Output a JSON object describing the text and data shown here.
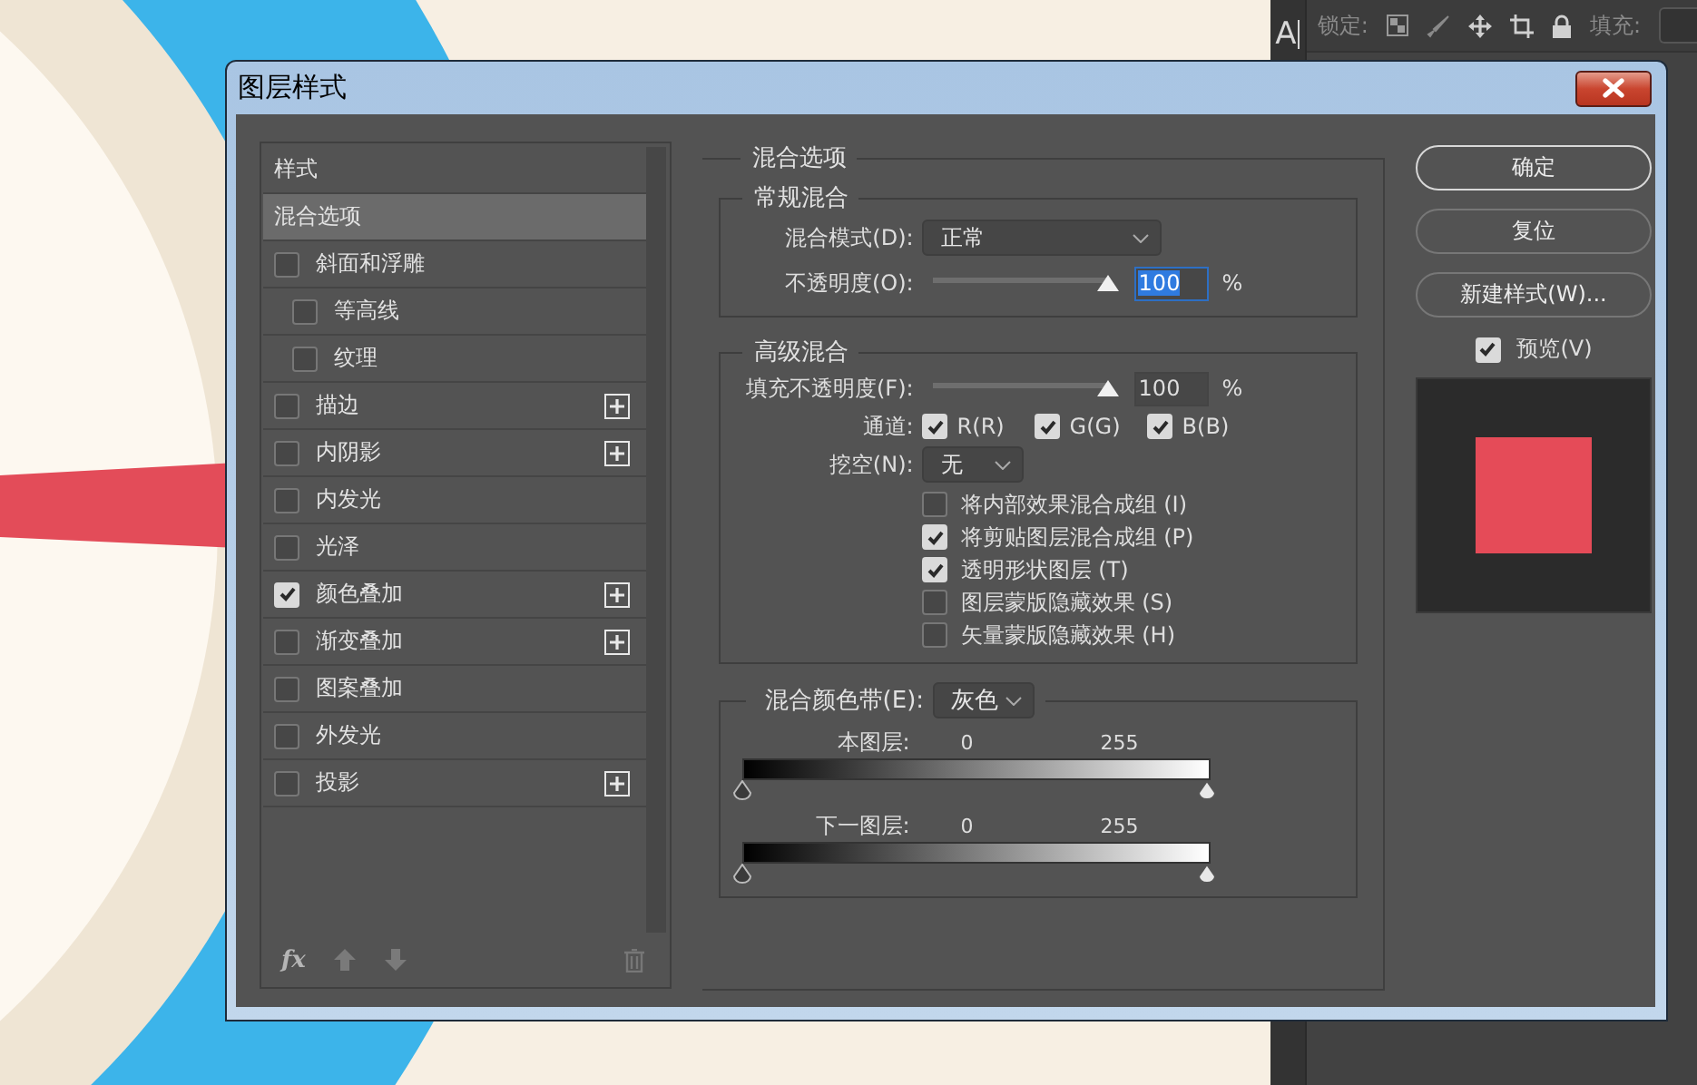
{
  "app": {
    "type_tool": "A",
    "lock_label": "锁定:",
    "fill_label": "填充:"
  },
  "dialog": {
    "title": "图层样式",
    "styles": {
      "items": [
        {
          "kind": "header",
          "label": "样式",
          "selected": false
        },
        {
          "kind": "option",
          "label": "混合选项",
          "selected": true
        },
        {
          "kind": "effect",
          "label": "斜面和浮雕",
          "checked": false,
          "addable": false,
          "selected": false,
          "children": [
            {
              "kind": "effect",
              "label": "等高线",
              "checked": false,
              "addable": false,
              "selected": false
            },
            {
              "kind": "effect",
              "label": "纹理",
              "checked": false,
              "addable": false,
              "selected": false
            }
          ]
        },
        {
          "kind": "effect",
          "label": "描边",
          "checked": false,
          "addable": true,
          "selected": false
        },
        {
          "kind": "effect",
          "label": "内阴影",
          "checked": false,
          "addable": true,
          "selected": false
        },
        {
          "kind": "effect",
          "label": "内发光",
          "checked": false,
          "addable": false,
          "selected": false
        },
        {
          "kind": "effect",
          "label": "光泽",
          "checked": false,
          "addable": false,
          "selected": false
        },
        {
          "kind": "effect",
          "label": "颜色叠加",
          "checked": true,
          "addable": true,
          "selected": false
        },
        {
          "kind": "effect",
          "label": "渐变叠加",
          "checked": false,
          "addable": true,
          "selected": false
        },
        {
          "kind": "effect",
          "label": "图案叠加",
          "checked": false,
          "addable": false,
          "selected": false
        },
        {
          "kind": "effect",
          "label": "外发光",
          "checked": false,
          "addable": false,
          "selected": false
        },
        {
          "kind": "effect",
          "label": "投影",
          "checked": false,
          "addable": true,
          "selected": false
        }
      ],
      "fx_label": "fx"
    },
    "blending": {
      "title": "混合选项",
      "general": {
        "title": "常规混合",
        "mode": {
          "label": "混合模式(D):",
          "value": "正常"
        },
        "opacity": {
          "label": "不透明度(O):",
          "level": 1,
          "value": "100",
          "unit": "%",
          "focused": true
        }
      },
      "advanced": {
        "title": "高级混合",
        "fill_opacity": {
          "label": "填充不透明度(F):",
          "level": 1,
          "value": "100",
          "unit": "%",
          "focused": false
        },
        "channels_label": "通道:",
        "channels": [
          {
            "label": "R(R)",
            "checked": true
          },
          {
            "label": "G(G)",
            "checked": true
          },
          {
            "label": "B(B)",
            "checked": true
          }
        ],
        "knockout": {
          "label": "挖空(N):",
          "value": "无"
        },
        "options": [
          {
            "label": "将内部效果混合成组 (I)",
            "checked": false
          },
          {
            "label": "将剪贴图层混合成组 (P)",
            "checked": true
          },
          {
            "label": "透明形状图层 (T)",
            "checked": true
          },
          {
            "label": "图层蒙版隐藏效果 (S)",
            "checked": false
          },
          {
            "label": "矢量蒙版隐藏效果 (H)",
            "checked": false
          }
        ]
      },
      "blend_if": {
        "label": "混合颜色带(E):",
        "value": "灰色",
        "bars": [
          {
            "label": "本图层:",
            "low": "0",
            "high": "255"
          },
          {
            "label": "下一图层:",
            "low": "0",
            "high": "255"
          }
        ]
      }
    },
    "buttons": [
      {
        "label": "确定",
        "default": true
      },
      {
        "label": "复位",
        "default": false
      },
      {
        "label": "新建样式(W)...",
        "default": false
      }
    ],
    "preview": {
      "label": "预览(V)",
      "checked": true
    }
  }
}
